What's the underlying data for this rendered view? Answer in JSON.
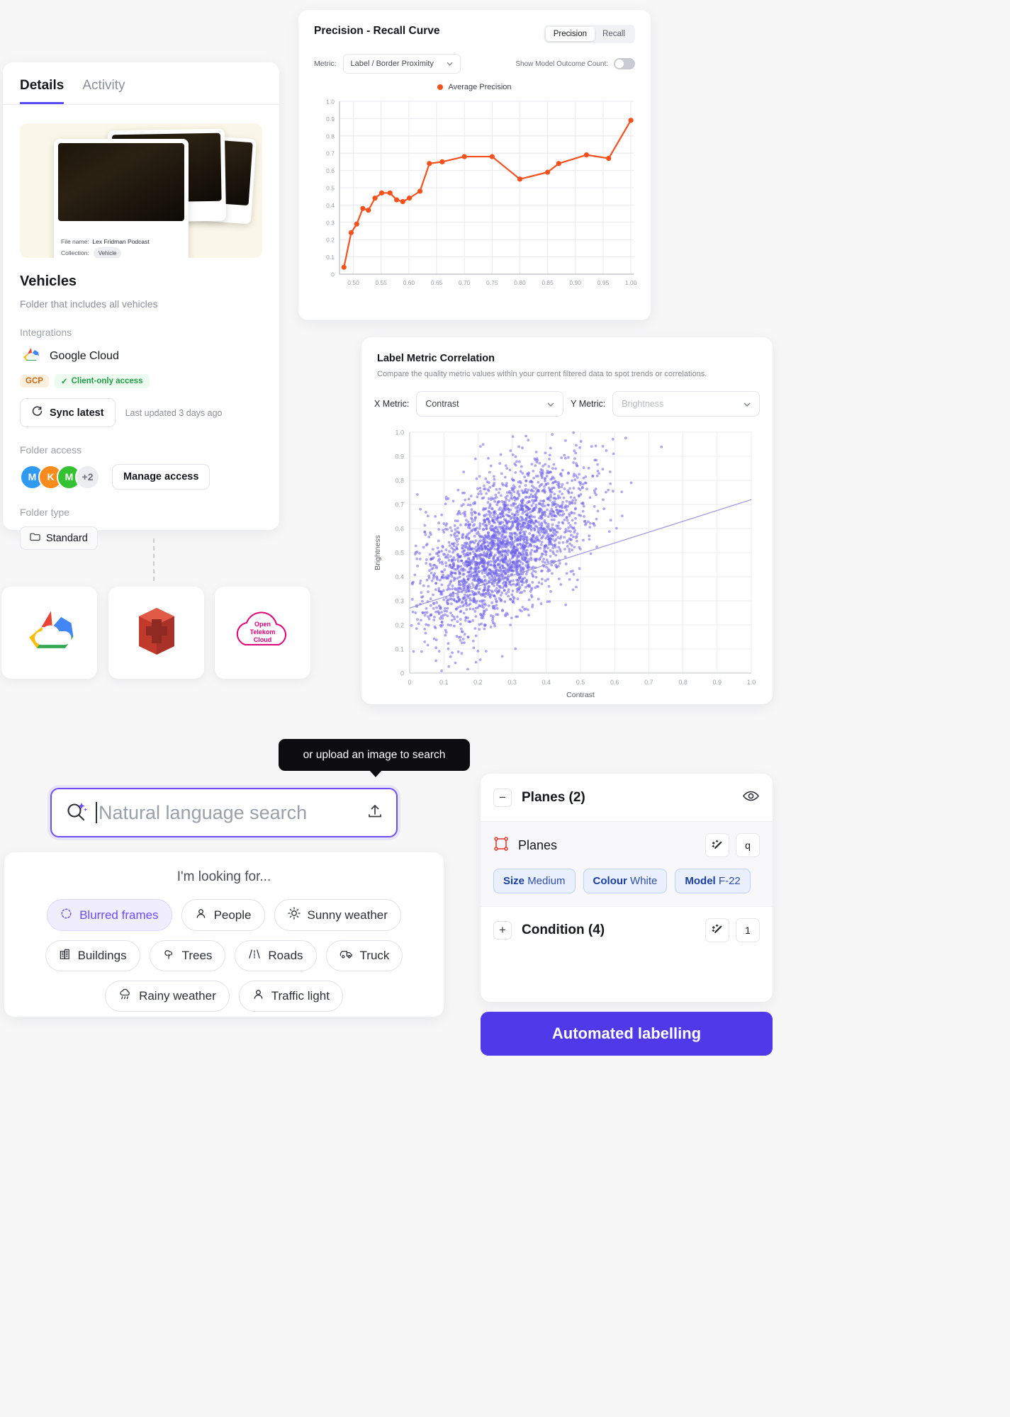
{
  "details": {
    "tabs": [
      {
        "label": "Details",
        "active": true
      },
      {
        "label": "Activity",
        "active": false
      }
    ],
    "preview": {
      "file_name_label": "File name:",
      "file_name_value": "Lex Fridman Podcast",
      "collection_label": "Collection:",
      "collection_value": "Vehicle"
    },
    "folder_title": "Vehicles",
    "folder_desc": "Folder that includes all vehicles",
    "integrations_label": "Integrations",
    "integration_name": "Google Cloud",
    "badge_gcp": "GCP",
    "badge_access": "Client-only access",
    "sync_button": "Sync latest",
    "last_updated": "Last updated 3 days ago",
    "folder_access_label": "Folder access",
    "avatars": [
      {
        "initial": "M",
        "color": "#2e9bf0"
      },
      {
        "initial": "K",
        "color": "#f78b1e"
      },
      {
        "initial": "M",
        "color": "#34c132"
      },
      {
        "initial": "+2",
        "color": "#ebedf0"
      }
    ],
    "manage_access_button": "Manage access",
    "folder_type_label": "Folder type",
    "folder_type_value": "Standard"
  },
  "cloud_logos": [
    {
      "name": "google-cloud-logo"
    },
    {
      "name": "aws-logo"
    },
    {
      "name": "open-telekom-cloud-logo",
      "text": "Open\nTelekom\nCloud"
    }
  ],
  "pr_panel": {
    "title": "Precision - Recall Curve",
    "segments": [
      {
        "label": "Precision",
        "active": true
      },
      {
        "label": "Recall",
        "active": false
      }
    ],
    "metric_label": "Metric:",
    "metric_value": "Label / Border Proximity",
    "toggle_label": "Show Model Outcome Count:",
    "toggle_on": false,
    "legend": "Average Precision"
  },
  "corr_panel": {
    "title": "Label Metric Correlation",
    "subtitle": "Compare the quality metric values within your current filtered data to spot trends or correlations.",
    "x_metric_label": "X Metric:",
    "x_metric_value": "Contrast",
    "y_metric_label": "Y Metric:",
    "y_metric_value": "Brightness"
  },
  "search": {
    "tooltip": "or upload an image to search",
    "placeholder": "Natural language search",
    "value": "",
    "upload_icon": "upload-icon",
    "search_icon": "sparkle-search-icon"
  },
  "suggestions": {
    "title": "I'm looking for...",
    "chips": [
      {
        "label": "Blurred frames",
        "icon": "blur-icon",
        "highlight": true
      },
      {
        "label": "People",
        "icon": "person-icon",
        "highlight": false
      },
      {
        "label": "Sunny weather",
        "icon": "sun-icon",
        "highlight": false
      },
      {
        "label": "Buildings",
        "icon": "building-icon",
        "highlight": false
      },
      {
        "label": "Trees",
        "icon": "tree-icon",
        "highlight": false
      },
      {
        "label": "Roads",
        "icon": "road-icon",
        "highlight": false
      },
      {
        "label": "Truck",
        "icon": "truck-icon",
        "highlight": false
      },
      {
        "label": "Rainy weather",
        "icon": "rain-icon",
        "highlight": false
      },
      {
        "label": "Traffic light",
        "icon": "traffic-light-icon",
        "highlight": false
      }
    ]
  },
  "label_panel": {
    "header_title": "Planes (2)",
    "collapse_glyph": "−",
    "eye_icon": "eye-icon",
    "item_label": "Planes",
    "item_shortcut": "q",
    "magic_icon": "magic-wand-icon",
    "attributes": [
      {
        "key": "Size",
        "value": "Medium"
      },
      {
        "key": "Colour",
        "value": "White"
      },
      {
        "key": "Model",
        "value": "F-22"
      }
    ],
    "footer_title": "Condition (4)",
    "expand_glyph": "+",
    "footer_shortcut": "1"
  },
  "automated_button": "Automated labelling",
  "colors": {
    "accent": "#4f39e8",
    "search_border": "#6d4df6",
    "curve": "#f4511e",
    "scatter": "#6f63e8",
    "chip_highlight": "#6b4df2"
  },
  "chart_data": [
    {
      "type": "line",
      "title": "Precision - Recall Curve",
      "xlabel": "",
      "ylabel": "",
      "xlim": [
        0.475,
        1.005
      ],
      "ylim": [
        0,
        1.0
      ],
      "xticks": [
        0.5,
        0.55,
        0.6,
        0.65,
        0.7,
        0.75,
        0.8,
        0.85,
        0.9,
        0.95,
        1.0
      ],
      "yticks": [
        0,
        0.1,
        0.2,
        0.3,
        0.4,
        0.5,
        0.6,
        0.7,
        0.8,
        0.9,
        1.0
      ],
      "grid": true,
      "legend": "Average Precision",
      "legend_position": "top-center",
      "series": [
        {
          "name": "Average Precision",
          "color": "#f4511e",
          "points": [
            [
              0.483,
              0.04
            ],
            [
              0.496,
              0.24
            ],
            [
              0.506,
              0.29
            ],
            [
              0.517,
              0.38
            ],
            [
              0.527,
              0.37
            ],
            [
              0.539,
              0.44
            ],
            [
              0.551,
              0.47
            ],
            [
              0.566,
              0.47
            ],
            [
              0.578,
              0.43
            ],
            [
              0.589,
              0.42
            ],
            [
              0.601,
              0.44
            ],
            [
              0.62,
              0.48
            ],
            [
              0.637,
              0.64
            ],
            [
              0.66,
              0.65
            ],
            [
              0.7,
              0.68
            ],
            [
              0.75,
              0.68
            ],
            [
              0.8,
              0.55
            ],
            [
              0.85,
              0.59
            ],
            [
              0.87,
              0.64
            ],
            [
              0.92,
              0.69
            ],
            [
              0.96,
              0.67
            ],
            [
              1.0,
              0.89
            ]
          ]
        }
      ]
    },
    {
      "type": "scatter",
      "title": "Label Metric Correlation",
      "xlabel": "Contrast",
      "ylabel": "Brightness",
      "xlim": [
        0,
        1.0
      ],
      "ylim": [
        0,
        1.0
      ],
      "xticks": [
        0,
        0.1,
        0.2,
        0.3,
        0.4,
        0.5,
        0.6,
        0.7,
        0.8,
        0.9,
        1.0
      ],
      "yticks": [
        0,
        0.1,
        0.2,
        0.3,
        0.4,
        0.5,
        0.6,
        0.7,
        0.8,
        0.9,
        1.0
      ],
      "grid": true,
      "point_color": "#6f63e8",
      "n_points": 2600,
      "cluster": {
        "x_mean": 0.27,
        "y_mean": 0.52,
        "x_sd": 0.12,
        "y_sd": 0.17,
        "correlation": 0.55
      },
      "trendline": {
        "from": [
          0.0,
          0.27
        ],
        "to": [
          1.0,
          0.72
        ]
      }
    }
  ]
}
